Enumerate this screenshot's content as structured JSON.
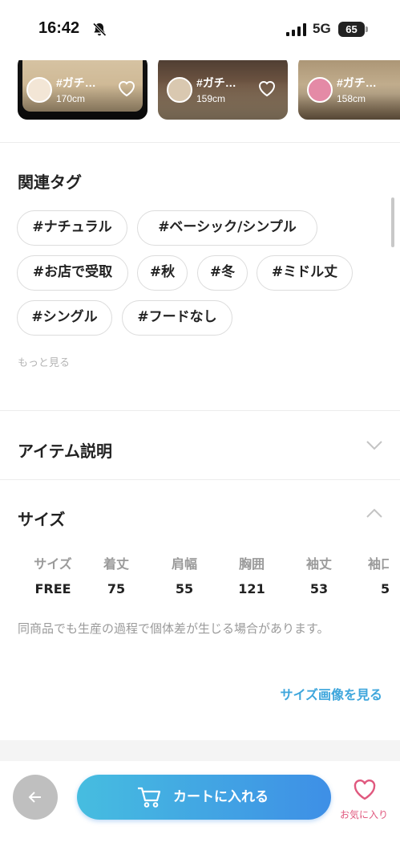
{
  "status_bar": {
    "time": "16:42",
    "network": "5G",
    "battery": "65"
  },
  "coordinates": {
    "cards": [
      {
        "tag": "#ガチ…",
        "height": "170cm"
      },
      {
        "tag": "#ガチ…",
        "height": "159cm"
      },
      {
        "tag": "#ガチ…",
        "height": "158cm"
      }
    ]
  },
  "related_tags": {
    "title": "関連タグ",
    "tags": [
      "#ナチュラル",
      "#ベーシック/シンプル",
      "#お店で受取",
      "#秋",
      "#冬",
      "#ミドル丈",
      "#シングル",
      "#フードなし"
    ],
    "more_label": "もっと見る"
  },
  "item_description": {
    "title": "アイテム説明"
  },
  "size": {
    "title": "サイズ",
    "headers": [
      "サイズ",
      "着丈",
      "肩幅",
      "胸囲",
      "袖丈",
      "袖口"
    ],
    "values": [
      "FREE",
      "75",
      "55",
      "121",
      "53",
      "5"
    ],
    "note": "同商品でも生産の過程で個体差が生じる場合があります。",
    "image_link": "サイズ画像を見る"
  },
  "bottom_bar": {
    "cart_label": "カートに入れる",
    "favorite_label": "お気に入り"
  },
  "colors": {
    "accent_blue": "#3ea6dc",
    "favorite_pink": "#e0587e"
  }
}
